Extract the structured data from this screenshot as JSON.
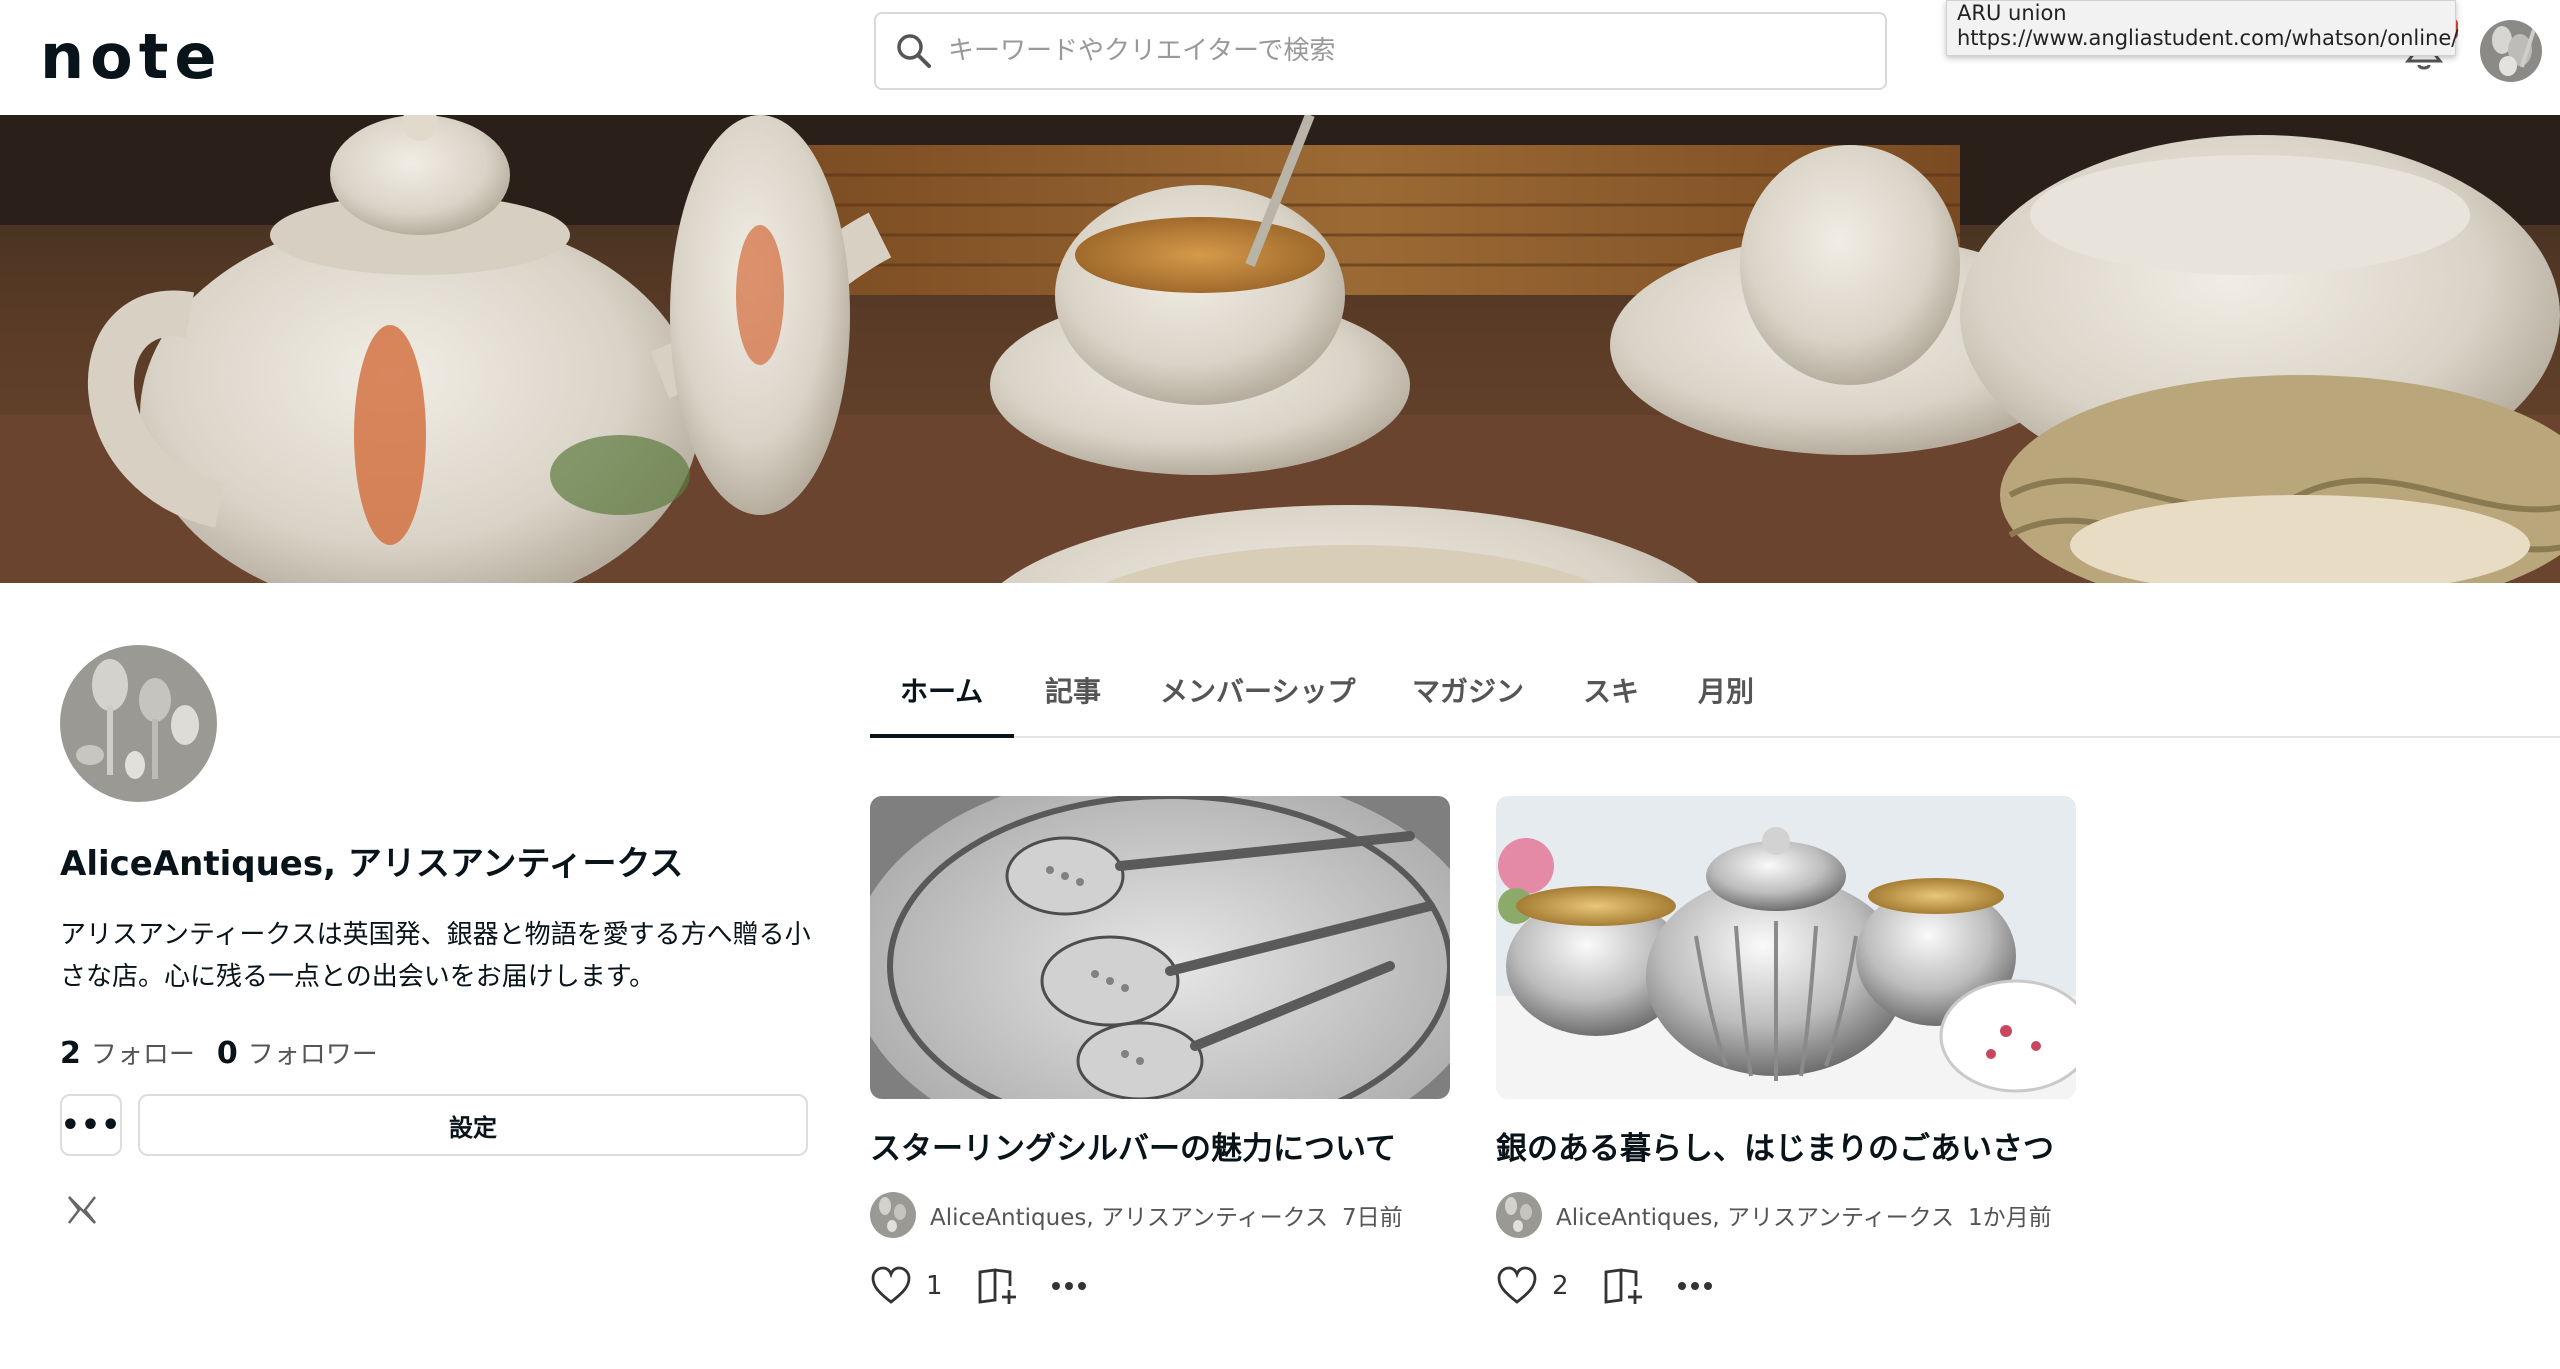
{
  "header": {
    "logo": "note",
    "search_placeholder": "キーワードやクリエイターで検索",
    "tooltip_line1": "ARU union",
    "tooltip_line2": "https://www.angliastudent.com/whatson/online/"
  },
  "profile": {
    "name": "AliceAntiques, アリスアンティークス",
    "bio": "アリスアンティークスは英国発、銀器と物語を愛する方へ贈る小さな店。心に残る一点との出会いをお届けします。",
    "follow_count": "2",
    "follow_label": "フォロー",
    "follower_count": "0",
    "follower_label": "フォロワー",
    "more_label": "•••",
    "settings_label": "設定"
  },
  "tabs": [
    {
      "label": "ホーム"
    },
    {
      "label": "記事"
    },
    {
      "label": "メンバーシップ"
    },
    {
      "label": "マガジン"
    },
    {
      "label": "スキ"
    },
    {
      "label": "月別"
    }
  ],
  "articles": [
    {
      "title": "スターリングシルバーの魅力について",
      "author": "AliceAntiques, アリスアンティークス",
      "date": "7日前",
      "likes": "1"
    },
    {
      "title": "銀のある暮らし、はじまりのごあいさつ",
      "author": "AliceAntiques, アリスアンティークス",
      "date": "1か月前",
      "likes": "2"
    }
  ],
  "colors": {
    "text": "#08131a",
    "muted": "#555555",
    "border": "#dcdcdc",
    "badge": "#e8403a"
  }
}
